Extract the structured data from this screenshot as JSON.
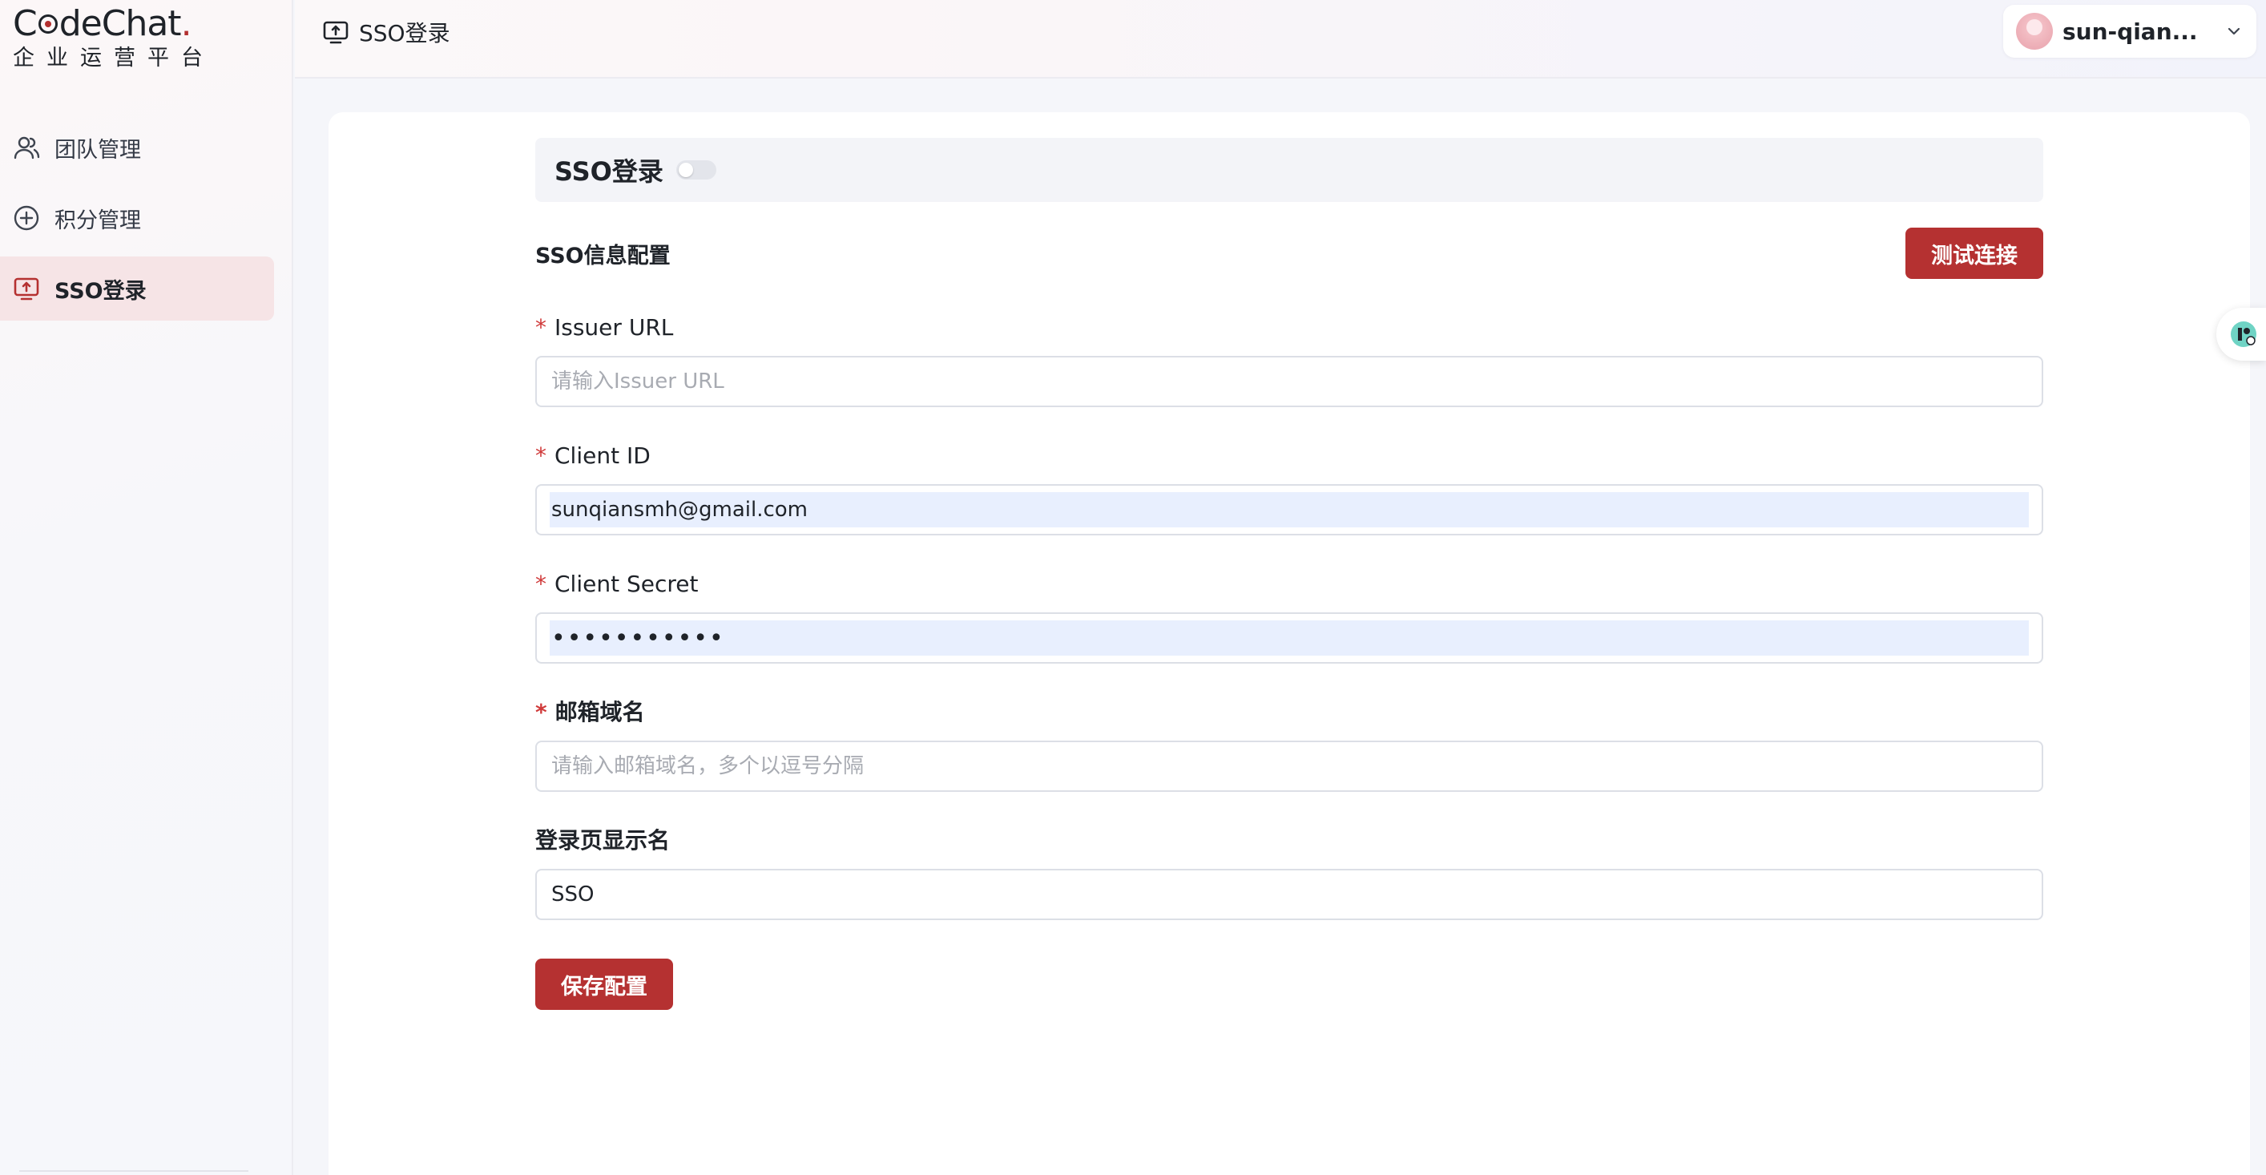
{
  "brand": {
    "logo_text_before": "C",
    "logo_text_after": "deChat",
    "logo_dot": ".",
    "subtitle": "企业运营平台"
  },
  "sidebar": {
    "items": [
      {
        "label": "团队管理",
        "icon": "team-icon",
        "active": false
      },
      {
        "label": "积分管理",
        "icon": "points-icon",
        "active": false
      },
      {
        "label": "SSO登录",
        "icon": "sso-icon",
        "active": true
      }
    ]
  },
  "header": {
    "page_title": "SSO登录",
    "user_name": "sun-qian..."
  },
  "sso": {
    "toggle_title": "SSO登录",
    "toggle_on": false,
    "section_title": "SSO信息配置",
    "test_button": "测试连接",
    "save_button": "保存配置"
  },
  "fields": {
    "issuer_url": {
      "label": "Issuer URL",
      "required": true,
      "value": "",
      "placeholder": "请输入Issuer URL"
    },
    "client_id": {
      "label": "Client ID",
      "required": true,
      "value": "sunqiansmh@gmail.com",
      "placeholder": ""
    },
    "client_secret": {
      "label": "Client Secret",
      "required": true,
      "value": "•••••••••••",
      "placeholder": ""
    },
    "email_domain": {
      "label": "邮箱域名",
      "required": true,
      "value": "",
      "placeholder": "请输入邮箱域名，多个以逗号分隔"
    },
    "login_display_name": {
      "label": "登录页显示名",
      "required": false,
      "value": "SSO",
      "placeholder": ""
    }
  },
  "colors": {
    "primary": "#b53131",
    "active_nav_bg": "#f6e4e6",
    "required": "#d03a3a"
  }
}
